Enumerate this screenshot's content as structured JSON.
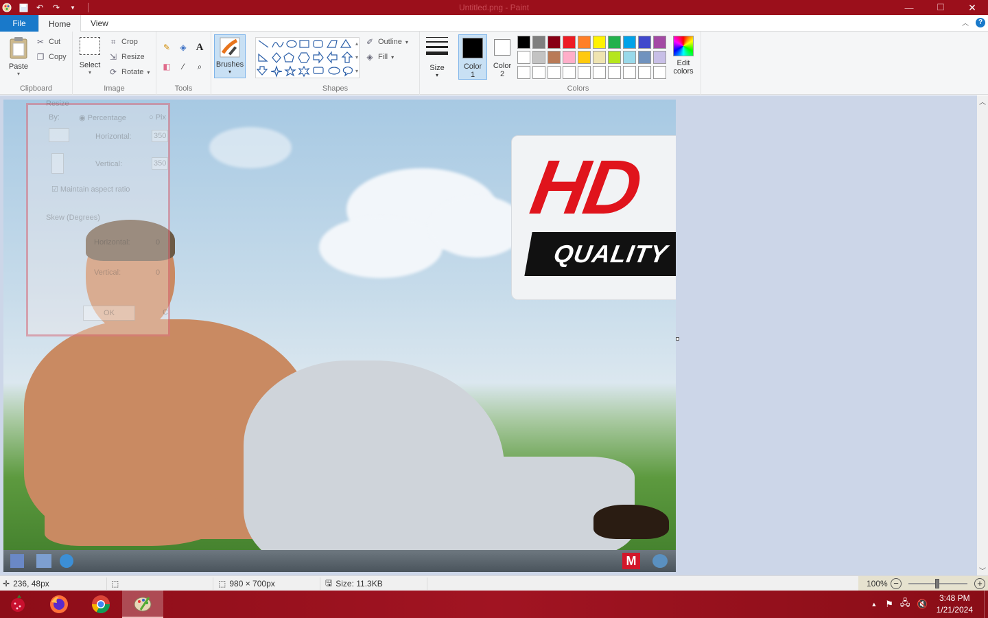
{
  "window": {
    "title": "Untitled.png - Paint"
  },
  "quick_access": {
    "icons": [
      "paint-app-icon",
      "save-icon",
      "undo-icon",
      "redo-icon",
      "customize-dropdown-icon"
    ]
  },
  "tabs": {
    "file": "File",
    "home": "Home",
    "view": "View"
  },
  "ribbon": {
    "clipboard": {
      "label": "Clipboard",
      "paste": "Paste",
      "cut": "Cut",
      "copy": "Copy"
    },
    "image": {
      "label": "Image",
      "select": "Select",
      "crop": "Crop",
      "resize": "Resize",
      "rotate": "Rotate"
    },
    "tools": {
      "label": "Tools"
    },
    "brushes": {
      "label": "Brushes"
    },
    "shapes": {
      "label": "Shapes",
      "outline": "Outline",
      "fill": "Fill"
    },
    "size": {
      "label": "Size"
    },
    "colors": {
      "label": "Colors",
      "color1_label": "Color",
      "color1_num": "1",
      "color2_label": "Color",
      "color2_num": "2",
      "edit_colors_line1": "Edit",
      "edit_colors_line2": "colors",
      "color1_value": "#000000",
      "color2_value": "#ffffff",
      "palette_row1": [
        "#000000",
        "#7f7f7f",
        "#880015",
        "#ed1c24",
        "#ff7f27",
        "#fff200",
        "#22b14c",
        "#00a2e8",
        "#3f48cc",
        "#a349a4"
      ],
      "palette_row2": [
        "#ffffff",
        "#c3c3c3",
        "#b97a57",
        "#ffaec9",
        "#ffc90e",
        "#efe4b0",
        "#b5e61d",
        "#99d9ea",
        "#7092be",
        "#c8bfe7"
      ],
      "palette_row3": [
        "#ffffff",
        "#ffffff",
        "#ffffff",
        "#ffffff",
        "#ffffff",
        "#ffffff",
        "#ffffff",
        "#ffffff",
        "#ffffff",
        "#ffffff"
      ]
    }
  },
  "canvas": {
    "hd_text": "HD",
    "quality_text": "QUALITY"
  },
  "ghost_dialog": {
    "resize": "Resize",
    "by": "By:",
    "percentage": "Percentage",
    "pixels": "Pix",
    "horizontal": "Horizontal:",
    "horizontal_value": "350",
    "vertical": "Vertical:",
    "vertical_value": "350",
    "maintain": "Maintain aspect ratio",
    "skew": "Skew (Degrees)",
    "skew_h": "Horizontal:",
    "skew_h_value": "0",
    "skew_v": "Vertical:",
    "skew_v_value": "0",
    "ok": "OK",
    "cancel": "C"
  },
  "statusbar": {
    "cursor_pos": "236, 48px",
    "dimensions": "980 × 700px",
    "size": "Size: 11.3KB",
    "zoom": "100%"
  },
  "taskbar": {
    "time": "3:48 PM",
    "date": "1/21/2024"
  }
}
